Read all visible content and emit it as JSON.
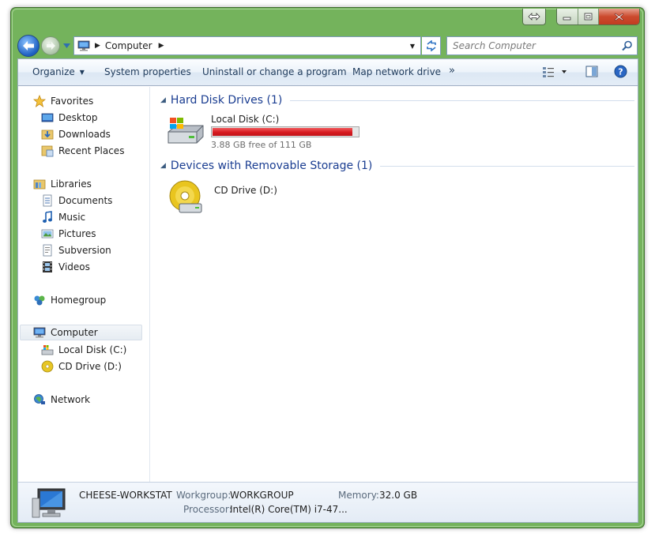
{
  "address": {
    "crumb": "Computer"
  },
  "search": {
    "placeholder": "Search Computer"
  },
  "toolbar": {
    "organize": "Organize",
    "system_properties": "System properties",
    "uninstall": "Uninstall or change a program",
    "map_drive": "Map network drive",
    "more": "»"
  },
  "sidebar": {
    "favorites": {
      "label": "Favorites",
      "items": [
        "Desktop",
        "Downloads",
        "Recent Places"
      ]
    },
    "libraries": {
      "label": "Libraries",
      "items": [
        "Documents",
        "Music",
        "Pictures",
        "Subversion",
        "Videos"
      ]
    },
    "homegroup": "Homegroup",
    "computer": {
      "label": "Computer",
      "items": [
        "Local Disk (C:)",
        "CD Drive (D:)"
      ]
    },
    "network": "Network"
  },
  "groups": {
    "hard_disks": {
      "title": "Hard Disk Drives (1)",
      "drive": {
        "name": "Local Disk (C:)",
        "free_text": "3.88 GB free of 111 GB",
        "used_fraction": 0.965,
        "bar_color": "#d81b20"
      }
    },
    "removable": {
      "title": "Devices with Removable Storage (1)",
      "drive": {
        "name": "CD Drive (D:)"
      }
    }
  },
  "details": {
    "name": "CHEESE-WORKSTAT",
    "workgroup_label": "Workgroup:",
    "workgroup_value": "WORKGROUP",
    "memory_label": "Memory:",
    "memory_value": "32.0 GB",
    "processor_label": "Processor:",
    "processor_value": "Intel(R) Core(TM) i7-47..."
  },
  "colors": {
    "frame": "#74b35c",
    "group_title": "#1a3d91",
    "close_button": "#c13d21"
  }
}
